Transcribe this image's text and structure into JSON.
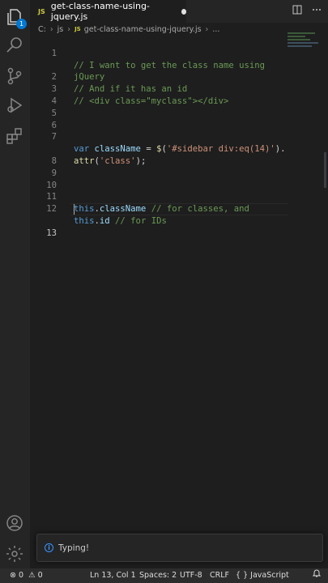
{
  "tab": {
    "file_type": "JS",
    "filename": "get-class-name-using-jquery.js",
    "split_icon": "split-editor-icon",
    "more_icon": "more-actions-icon"
  },
  "breadcrumb": {
    "drive": "C:",
    "folder": "js",
    "file_type": "JS",
    "file": "get-class-name-using-jquery.js",
    "more": "..."
  },
  "activity_bar": {
    "explorer_badge": "1",
    "icons": [
      "explorer-icon",
      "search-icon",
      "source-control-icon",
      "run-debug-icon",
      "extensions-icon",
      "account-icon",
      "settings-gear-icon"
    ]
  },
  "code": {
    "line_numbers": [
      "1",
      "",
      "2",
      "3",
      "4",
      "5",
      "6",
      "7",
      "",
      "8",
      "9",
      "10",
      "11",
      "12",
      "13"
    ],
    "line1": "// I want to get the class name using",
    "line1_wrap": "jQuery",
    "line2": "// And if it has an id",
    "line3": "// <div class=\"myclass\"></div>",
    "line7_kw": "var",
    "line7_var": "className",
    "line7_eq": " = ",
    "line7_fn": "$",
    "line7_open": "(",
    "line7_str": "'#sidebar div:eq(14)'",
    "line7_close": ").",
    "line7_wrap_fn": "attr",
    "line7_wrap_open": "(",
    "line7_wrap_str": "'class'",
    "line7_wrap_close": ");",
    "line11_kw": "this",
    "line11_dot": ".",
    "line11_var": "className",
    "line11_cm": " // for classes, and",
    "line12_kw": "this",
    "line12_dot": ".",
    "line12_var": "id",
    "line12_cm": " // for IDs"
  },
  "notification": {
    "icon": "info-icon",
    "message": "Typing!"
  },
  "statusbar": {
    "errors": "0",
    "warnings": "0",
    "position": "Ln 13, Col 1",
    "spaces": "Spaces: 2",
    "encoding": "UTF-8",
    "eol": "CRLF",
    "language_icon": "{ }",
    "language": "JavaScript",
    "colors": {
      "background": "#2c2c2c",
      "accent": "#0078d4"
    }
  }
}
